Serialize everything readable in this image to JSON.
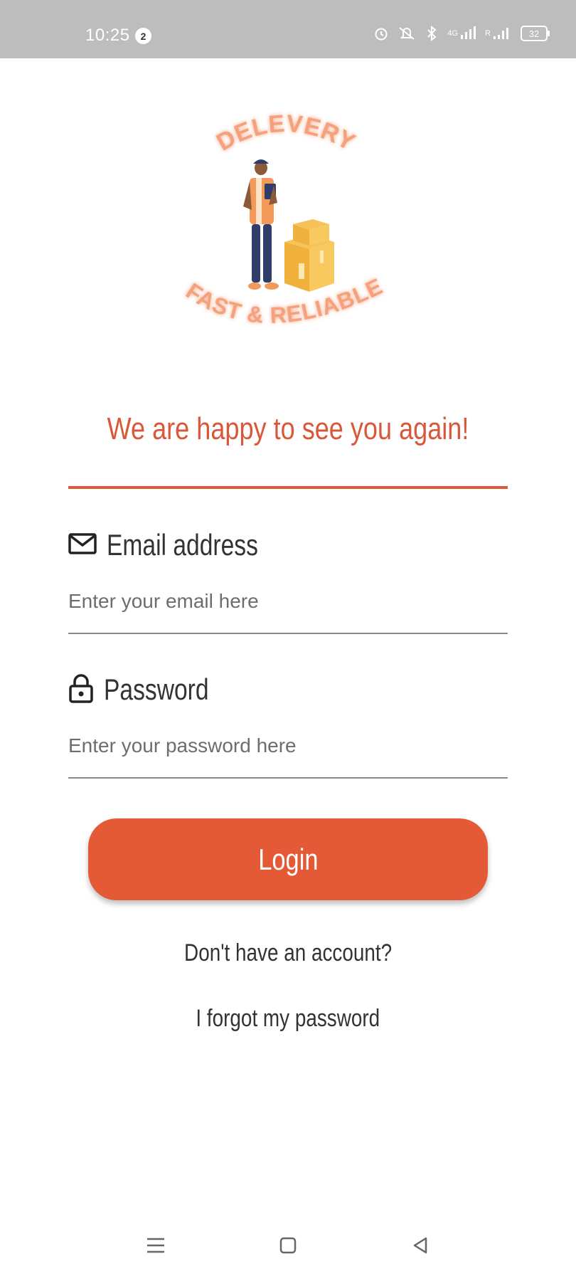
{
  "status_bar": {
    "time": "10:25",
    "notification_count": "2",
    "network": "4G",
    "roaming": "R",
    "battery": "32"
  },
  "logo": {
    "top_text": "DELEVERY",
    "bottom_text": "FAST & RELIABLE"
  },
  "tagline": "We are happy to see you again!",
  "email": {
    "label": "Email address",
    "placeholder": "Enter your email here",
    "icon": "mail-icon"
  },
  "password": {
    "label": "Password",
    "placeholder": "Enter your password here",
    "icon": "lock-icon"
  },
  "login_button": "Login",
  "links": {
    "signup": "Don't have an account?",
    "forgot": "I forgot my password"
  },
  "colors": {
    "accent": "#e55a36",
    "tagline": "#d9583a",
    "status_bar": "#bdbdbd"
  },
  "nav_bar": {
    "icons": [
      "menu-icon",
      "home-square-icon",
      "back-triangle-icon"
    ]
  }
}
